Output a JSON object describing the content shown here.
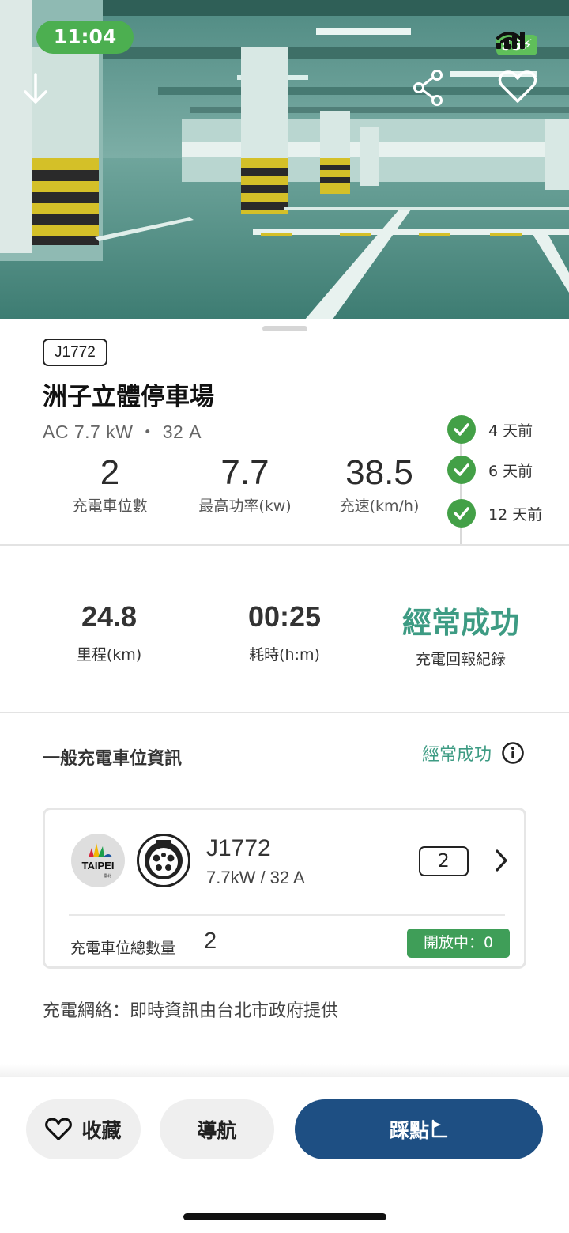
{
  "status_bar": {
    "time": "11:04",
    "battery": "55"
  },
  "hero": {
    "download_icon": "arrow-down-icon",
    "share_icon": "share-icon",
    "favorite_icon": "heart-outline-icon"
  },
  "station": {
    "connector_tag": "J1772",
    "name": "洲子立體停車場",
    "spec": "AC 7.7 kW ・ 32 A",
    "stats": [
      {
        "value": "2",
        "label": "充電車位數"
      },
      {
        "value": "7.7",
        "label": "最高功率(kw)"
      },
      {
        "value": "38.5",
        "label": "充速(km/h)"
      }
    ],
    "reports": [
      {
        "text": "4 天前",
        "icon": "check-circle-icon"
      },
      {
        "text": "6 天前",
        "icon": "check-circle-icon"
      },
      {
        "text": "12 天前",
        "icon": "check-circle-icon"
      }
    ]
  },
  "summary": {
    "mileage": {
      "value": "24.8",
      "label": "里程(km)"
    },
    "duration": {
      "value": "00:25",
      "label": "耗時(h:m)"
    },
    "record": {
      "value": "經常成功",
      "label": "充電回報紀錄"
    }
  },
  "section": {
    "title": "一般充電車位資訊",
    "status": "經常成功"
  },
  "charger_card": {
    "name": "J1772",
    "spec": "7.7kW / 32 A",
    "count": "2",
    "logo_text": "TAIPEI",
    "logo_sub": "臺北",
    "total_label": "充電車位總數量",
    "total_value": "2",
    "open_status": "開放中：0"
  },
  "network_info": "充電網絡：即時資訊由台北市政府提供",
  "actions": {
    "favorite_label": "收藏",
    "navigate_label": "導航",
    "checkin_label": "踩點"
  },
  "colors": {
    "accent_green": "#3d9b83",
    "check_green": "#43a047",
    "primary_blue": "#1e4f83",
    "badge_green": "#3f9e58"
  }
}
